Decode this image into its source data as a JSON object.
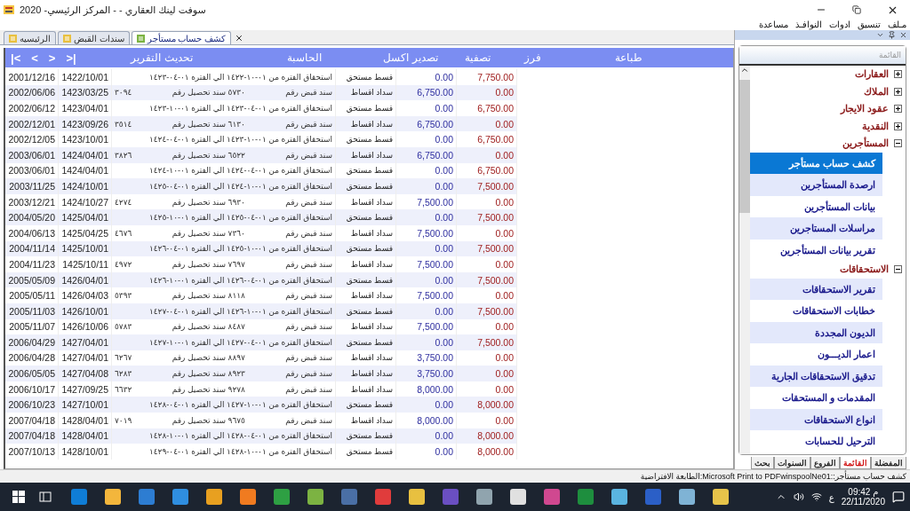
{
  "window": {
    "title": "سوفت لينك العقاري - - المركز الرئيسي- 2020"
  },
  "menu": [
    "مـلف",
    "تنسيق",
    "ادوات",
    "النوافـذ",
    "مساعدة"
  ],
  "document_tabs": [
    {
      "label": "كشف حساب مستأجر",
      "selected": true
    },
    {
      "label": "سندات القبض",
      "selected": false
    },
    {
      "label": "الرئيسيه",
      "selected": false
    }
  ],
  "toolbar": {
    "actions": [
      "طباعة",
      "فرز",
      "تصفية",
      "تصدير اكسل",
      "الحاسبة",
      "تحديث التقرير"
    ],
    "navigation": [
      ">|",
      ">",
      "<",
      "|<"
    ]
  },
  "report_table": {
    "rows": [
      {
        "gregorian_date": "2001/12/16",
        "hijri_date": "1422/10/01",
        "kind": "due",
        "description": [
          "استحقاق الفتره من ٠١-١٠-١٤٢٢ الي الفتره ٠١-٠٤-١٤٢٣"
        ],
        "type": "قسط مستحق",
        "credit": "0.00",
        "debit": "7,750.00"
      },
      {
        "gregorian_date": "2002/06/06",
        "hijri_date": "1423/03/25",
        "kind": "payment",
        "description": [
          "سند قبض رقم",
          "٥٧٣٠ سند تحصيل رقم",
          "٣٠٩٤"
        ],
        "type": "سداد اقساط",
        "credit": "6,750.00",
        "debit": "0.00"
      },
      {
        "gregorian_date": "2002/06/12",
        "hijri_date": "1423/04/01",
        "kind": "due",
        "description": [
          "استحقاق الفتره من ٠١-٠٤-١٤٢٣ الي الفتره ٠١-١٠-١٤٢٣"
        ],
        "type": "قسط مستحق",
        "credit": "0.00",
        "debit": "6,750.00"
      },
      {
        "gregorian_date": "2002/12/01",
        "hijri_date": "1423/09/26",
        "kind": "payment",
        "description": [
          "سند قبض رقم",
          "٦١٣٠ سند تحصيل رقم",
          "٣٥١٤"
        ],
        "type": "سداد اقساط",
        "credit": "6,750.00",
        "debit": "0.00"
      },
      {
        "gregorian_date": "2002/12/05",
        "hijri_date": "1423/10/01",
        "kind": "due",
        "description": [
          "استحقاق الفتره من ٠١-١٠-١٤٢٣ الي الفتره ٠١-٠٤-١٤٢٤"
        ],
        "type": "قسط مستحق",
        "credit": "0.00",
        "debit": "6,750.00"
      },
      {
        "gregorian_date": "2003/06/01",
        "hijri_date": "1424/04/01",
        "kind": "payment",
        "description": [
          "سند قبض رقم",
          "٦٥٢٢ سند تحصيل رقم",
          "٣٨٢٦"
        ],
        "type": "سداد اقساط",
        "credit": "6,750.00",
        "debit": "0.00"
      },
      {
        "gregorian_date": "2003/06/01",
        "hijri_date": "1424/04/01",
        "kind": "due",
        "description": [
          "استحقاق الفتره من ٠١-٠٤-١٤٢٤ الي الفتره ٠١-١٠-١٤٢٤"
        ],
        "type": "قسط مستحق",
        "credit": "0.00",
        "debit": "6,750.00"
      },
      {
        "gregorian_date": "2003/11/25",
        "hijri_date": "1424/10/01",
        "kind": "due",
        "description": [
          "استحقاق الفتره من ٠١-١٠-١٤٢٤ الي الفتره ٠١-٠٤-١٤٢٥"
        ],
        "type": "قسط مستحق",
        "credit": "0.00",
        "debit": "7,500.00"
      },
      {
        "gregorian_date": "2003/12/21",
        "hijri_date": "1424/10/27",
        "kind": "payment",
        "description": [
          "سند قبض رقم",
          "٦٩٣٠ سند تحصيل رقم",
          "٤٢٧٤"
        ],
        "type": "سداد اقساط",
        "credit": "7,500.00",
        "debit": "0.00"
      },
      {
        "gregorian_date": "2004/05/20",
        "hijri_date": "1425/04/01",
        "kind": "due",
        "description": [
          "استحقاق الفتره من ٠١-٠٤-١٤٢٥ الي الفتره ٠١-١٠-١٤٢٥"
        ],
        "type": "قسط مستحق",
        "credit": "0.00",
        "debit": "7,500.00"
      },
      {
        "gregorian_date": "2004/06/13",
        "hijri_date": "1425/04/25",
        "kind": "payment",
        "description": [
          "سند قبض رقم",
          "٧٣٦٠ سند تحصيل رقم",
          "٤٦٧٦"
        ],
        "type": "سداد اقساط",
        "credit": "7,500.00",
        "debit": "0.00"
      },
      {
        "gregorian_date": "2004/11/14",
        "hijri_date": "1425/10/01",
        "kind": "due",
        "description": [
          "استحقاق الفتره من ٠١-١٠-١٤٢٥ الي الفتره ٠١-٠٤-١٤٢٦"
        ],
        "type": "قسط مستحق",
        "credit": "0.00",
        "debit": "7,500.00"
      },
      {
        "gregorian_date": "2004/11/23",
        "hijri_date": "1425/10/11",
        "kind": "payment",
        "description": [
          "سند قبض رقم",
          "٧٦٩٧ سند تحصيل رقم",
          "٤٩٧٢"
        ],
        "type": "سداد اقساط",
        "credit": "7,500.00",
        "debit": "0.00"
      },
      {
        "gregorian_date": "2005/05/09",
        "hijri_date": "1426/04/01",
        "kind": "due",
        "description": [
          "استحقاق الفتره من ٠١-٠٤-١٤٢٦ الي الفتره ٠١-١٠-١٤٢٦"
        ],
        "type": "قسط مستحق",
        "credit": "0.00",
        "debit": "7,500.00"
      },
      {
        "gregorian_date": "2005/05/11",
        "hijri_date": "1426/04/03",
        "kind": "payment",
        "description": [
          "سند قبض رقم",
          "٨١١٨ سند تحصيل رقم",
          "٥٣٩٣"
        ],
        "type": "سداد اقساط",
        "credit": "7,500.00",
        "debit": "0.00"
      },
      {
        "gregorian_date": "2005/11/03",
        "hijri_date": "1426/10/01",
        "kind": "due",
        "description": [
          "استحقاق الفتره من ٠١-١٠-١٤٢٦ الي الفتره ٠١-٠٤-١٤٢٧"
        ],
        "type": "قسط مستحق",
        "credit": "0.00",
        "debit": "7,500.00"
      },
      {
        "gregorian_date": "2005/11/07",
        "hijri_date": "1426/10/06",
        "kind": "payment",
        "description": [
          "سند قبض رقم",
          "٨٤٨٧ سند تحصيل رقم",
          "٥٧٨٣"
        ],
        "type": "سداد اقساط",
        "credit": "7,500.00",
        "debit": "0.00"
      },
      {
        "gregorian_date": "2006/04/29",
        "hijri_date": "1427/04/01",
        "kind": "due",
        "description": [
          "استحقاق الفتره من ٠١-٠٤-١٤٢٧ الي الفتره ٠١-١٠-١٤٢٧"
        ],
        "type": "قسط مستحق",
        "credit": "0.00",
        "debit": "7,500.00"
      },
      {
        "gregorian_date": "2006/04/28",
        "hijri_date": "1427/04/01",
        "kind": "payment",
        "description": [
          "سند قبض رقم",
          "٨٨٩٧ سند تحصيل رقم",
          "٦٢٦٧"
        ],
        "type": "سداد اقساط",
        "credit": "3,750.00",
        "debit": "0.00"
      },
      {
        "gregorian_date": "2006/05/05",
        "hijri_date": "1427/04/08",
        "kind": "payment",
        "description": [
          "سند قبض رقم",
          "٨٩٢٣ سند تحصيل رقم",
          "٦٢٨٣"
        ],
        "type": "سداد اقساط",
        "credit": "3,750.00",
        "debit": "0.00"
      },
      {
        "gregorian_date": "2006/10/17",
        "hijri_date": "1427/09/25",
        "kind": "payment",
        "description": [
          "سند قبض رقم",
          "٩٢٧٨ سند تحصيل رقم",
          "٦٦٣٢"
        ],
        "type": "سداد اقساط",
        "credit": "8,000.00",
        "debit": "0.00"
      },
      {
        "gregorian_date": "2006/10/23",
        "hijri_date": "1427/10/01",
        "kind": "due",
        "description": [
          "استحقاق الفتره من ٠١-١٠-١٤٢٧ الي الفتره ٠١-٠٤-١٤٢٨"
        ],
        "type": "قسط مستحق",
        "credit": "0.00",
        "debit": "8,000.00"
      },
      {
        "gregorian_date": "2007/04/18",
        "hijri_date": "1428/04/01",
        "kind": "payment",
        "description": [
          "سند قبض رقم",
          "٩٦٧٥ سند تحصيل رقم",
          "٧٠١٩"
        ],
        "type": "سداد اقساط",
        "credit": "8,000.00",
        "debit": "0.00"
      },
      {
        "gregorian_date": "2007/04/18",
        "hijri_date": "1428/04/01",
        "kind": "due",
        "description": [
          "استحقاق الفتره من ٠١-٠٤-١٤٢٨ الي الفتره ٠١-١٠-١٤٢٨"
        ],
        "type": "قسط مستحق",
        "credit": "0.00",
        "debit": "8,000.00"
      },
      {
        "gregorian_date": "2007/10/13",
        "hijri_date": "1428/10/01",
        "kind": "due",
        "description": [
          "استحقاق الفتره من ٠١-١٠-١٤٢٨ الي الفتره ٠١-٠٤-١٤٢٩"
        ],
        "type": "قسط مستحق",
        "credit": "0.00",
        "debit": "8,000.00"
      }
    ]
  },
  "sidebar": {
    "header": "القائمة",
    "tree": [
      {
        "label": "العقارات",
        "expanded": false
      },
      {
        "label": "الملاك",
        "expanded": false
      },
      {
        "label": "عقود الايجار",
        "expanded": false
      },
      {
        "label": "النقدية",
        "expanded": false
      },
      {
        "label": "المستأجرين",
        "expanded": true,
        "children": [
          {
            "label": "كشف حساب مستأجر",
            "selected": true
          },
          {
            "label": "ارصدة المستأجرين",
            "selected": false
          },
          {
            "label": "بيانات المستأجرين",
            "selected": false
          },
          {
            "label": "مراسلات المستاجرين",
            "selected": false
          },
          {
            "label": "تقرير بيانات المستأجرين",
            "selected": false
          }
        ]
      },
      {
        "label": "الاستحقاقات",
        "expanded": true,
        "children": [
          {
            "label": "تقرير  الاستحقاقات",
            "selected": false
          },
          {
            "label": "خطابات الاستحقاقات",
            "selected": false
          },
          {
            "label": "الديون المجددة",
            "selected": false
          },
          {
            "label": "اعمار الديـــون",
            "selected": false
          },
          {
            "label": "تدقيق الاستحقاقات الجارية",
            "selected": false
          },
          {
            "label": "المقدمات و المستحقات",
            "selected": false
          },
          {
            "label": "انواع الاستحقاقات",
            "selected": false
          },
          {
            "label": "الترحيل للحسابات",
            "selected": false
          }
        ]
      }
    ],
    "bottom_tabs": [
      {
        "label": "المفضلة",
        "selected": false
      },
      {
        "label": "القائمة",
        "selected": true
      },
      {
        "label": "الفروع",
        "selected": false
      },
      {
        "label": "السنوات",
        "selected": false
      },
      {
        "label": "بحث",
        "selected": false
      }
    ]
  },
  "status_bar": "كشف حساب مستأجر::Microsoft Print to PDFwinspoolNe01:الطابعة الافتراضية",
  "taskbar": {
    "language": "ع",
    "time": "09:42 م",
    "date": "22/11/2020"
  }
}
